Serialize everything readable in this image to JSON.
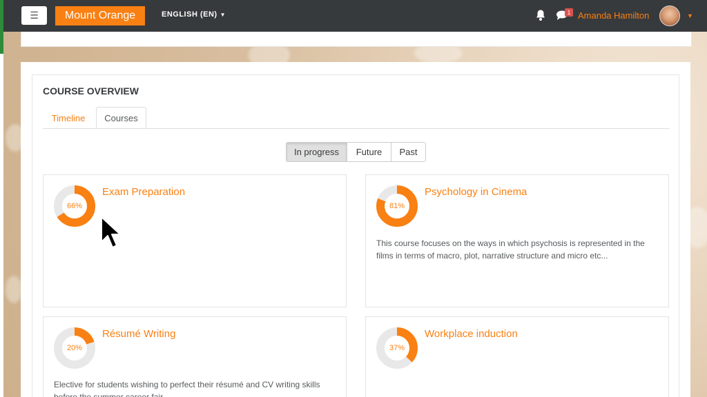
{
  "navbar": {
    "menu_icon": "hamburger-icon",
    "brand": "Mount Orange",
    "language": "ENGLISH (EN)",
    "notification_icon": "bell-icon",
    "messages_icon": "chat-icon",
    "messages_badge": "1",
    "user_name": "Amanda Hamilton",
    "user_menu_icon": "caret-down-icon"
  },
  "overview": {
    "title": "COURSE OVERVIEW",
    "tabs": [
      {
        "label": "Timeline",
        "active": false
      },
      {
        "label": "Courses",
        "active": true
      }
    ],
    "filters": [
      {
        "label": "In progress",
        "active": true
      },
      {
        "label": "Future",
        "active": false
      },
      {
        "label": "Past",
        "active": false
      }
    ],
    "courses": [
      {
        "name": "Exam Preparation",
        "progress": 66,
        "progress_label": "66%",
        "summary": ""
      },
      {
        "name": "Psychology in Cinema",
        "progress": 81,
        "progress_label": "81%",
        "summary": "This course focuses on the ways in which psychosis is represented in the films in terms of macro, plot, narrative structure and micro etc..."
      },
      {
        "name": "Résumé Writing",
        "progress": 20,
        "progress_label": "20%",
        "summary": "Elective for students wishing to perfect their résumé and CV writing skills before the summer career fair."
      },
      {
        "name": "Workplace induction",
        "progress": 37,
        "progress_label": "37%",
        "summary": ""
      }
    ]
  },
  "colors": {
    "accent": "#f98012",
    "navbar": "#373a3c",
    "track": "#e8e8e8"
  }
}
